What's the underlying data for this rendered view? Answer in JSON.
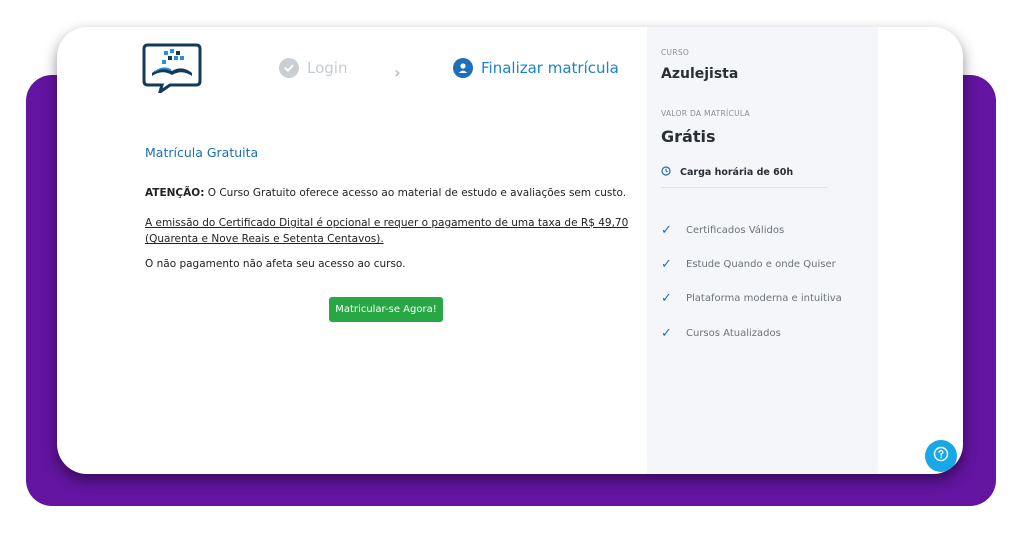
{
  "steps": {
    "login": "Login",
    "finalize": "Finalizar matrícula"
  },
  "main": {
    "title": "Matrícula Gratuita",
    "notice_label": "ATENÇÃO:",
    "notice_text": " O Curso Gratuito oferece acesso ao material de estudo e avaliações sem custo.",
    "certificate_fee_text": "A emissão do Certificado Digital é opcional e requer o pagamento de uma taxa de R$ 49,70 (Quarenta e Nove Reais e Setenta Centavos).",
    "non_payment_text": "O não pagamento não afeta seu acesso ao curso.",
    "enroll_button": "Matricular-se Agora!"
  },
  "summary": {
    "course_label": "CURSO",
    "course_name": "Azulejista",
    "price_label": "VALOR DA MATRÍCULA",
    "price": "Grátis",
    "hours": "Carga horária de 60h",
    "benefits": [
      "Certificados Válidos",
      "Estude Quando e onde Quiser",
      "Plataforma moderna e intuitiva",
      "Cursos Atualizados"
    ]
  },
  "colors": {
    "backdrop": "#6314a0",
    "accent_blue": "#1b6fb6",
    "enroll_green": "#28a745",
    "help_button": "#18a8e6"
  },
  "icons": [
    "logo-icon",
    "check-circle-icon",
    "chevron-right-icon",
    "graduation-icon",
    "clock-icon",
    "checkmark-icon",
    "help-icon"
  ]
}
